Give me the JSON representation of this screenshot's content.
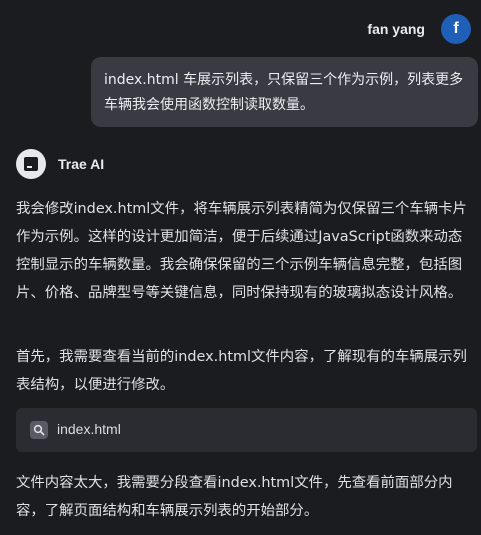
{
  "user": {
    "name": "fan yang",
    "avatar_letter": "f",
    "message": "index.html 车展示列表，只保留三个作为示例，列表更多车辆我会使用函数控制读取数量。"
  },
  "assistant": {
    "name": "Trae AI",
    "paragraph_1": "我会修改index.html文件，将车辆展示列表精简为仅保留三个车辆卡片作为示例。这样的设计更加简洁，便于后续通过JavaScript函数来动态控制显示的车辆数量。我会确保保留的三个示例车辆信息完整，包括图片、价格、品牌型号等关键信息，同时保持现有的玻璃拟态设计风格。",
    "paragraph_2": "首先，我需要查看当前的index.html文件内容，了解现有的车辆展示列表结构，以便进行修改。",
    "file_card": {
      "icon": "search-icon",
      "file_name": "index.html"
    },
    "paragraph_3": "文件内容太大，我需要分段查看index.html文件，先查看前面部分内容，了解页面结构和车辆展示列表的开始部分。"
  },
  "colors": {
    "background": "#1b1c20",
    "user_bubble": "#3a3b42",
    "avatar": "#1f5fb8",
    "file_card": "#2b2c32"
  }
}
